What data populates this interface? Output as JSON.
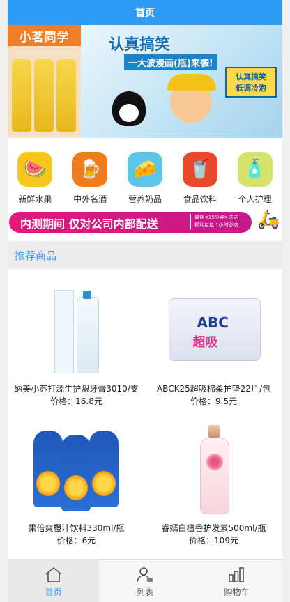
{
  "header": {
    "title": "首页"
  },
  "banner": {
    "left_brand": "小茗同学",
    "headline": "认真搞笑",
    "subheadline": "一大波漫画(瓶)来袭!",
    "tag_line1": "认真搞笑",
    "tag_line2": "低调冷泡"
  },
  "categories": [
    {
      "label": "新鲜水果",
      "icon": "watermelon-icon",
      "color": "#f7c51e",
      "glyph": "🍉"
    },
    {
      "label": "中外名酒",
      "icon": "beer-icon",
      "color": "#ef7d1e",
      "glyph": "🍺"
    },
    {
      "label": "营养奶品",
      "icon": "cheese-icon",
      "color": "#5bc6e8",
      "glyph": "🧀"
    },
    {
      "label": "食品饮料",
      "icon": "drink-icon",
      "color": "#e64a2a",
      "glyph": "🥤"
    },
    {
      "label": "个人护理",
      "icon": "toiletries-icon",
      "color": "#d6e36a",
      "glyph": "🧴"
    }
  ],
  "promo": {
    "main": "内测期间  仅对公司内部配送",
    "sub_line1": "最快<15分钟>送达",
    "sub_line2": "福利包包  1小时必达"
  },
  "section": {
    "title": "推荐商品"
  },
  "products": [
    {
      "name": "纳美小苏打源生护龈牙膏3010/支",
      "price": "价格：16.8元",
      "image": "toothpaste"
    },
    {
      "name": "ABCK25超吸棉柔护垫22片/包",
      "price": "价格：9.5元",
      "image": "pads"
    },
    {
      "name": "果倍爽橙汁饮料330ml/瓶",
      "price": "价格：6元",
      "image": "juice"
    },
    {
      "name": "睿嫣白檀香护发素500ml/瓶",
      "price": "价格：109元",
      "image": "conditioner"
    }
  ],
  "product_art": {
    "pad_brand": "ABC",
    "pad_label": "超吸"
  },
  "tabs": [
    {
      "label": "首页",
      "icon": "home-icon",
      "active": true
    },
    {
      "label": "列表",
      "icon": "user-list-icon",
      "active": false
    },
    {
      "label": "购物车",
      "icon": "bar-chart-icon",
      "active": false
    }
  ],
  "colors": {
    "accent": "#2e9bf5",
    "promo": "#e4177c"
  }
}
